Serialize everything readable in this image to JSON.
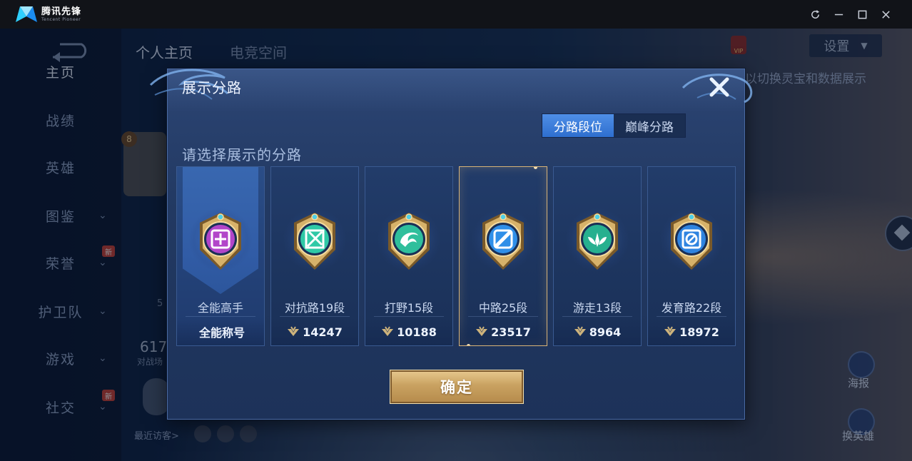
{
  "window": {
    "brand_name": "腾讯先锋",
    "brand_subtitle": "Tencent Pioneer",
    "controls": [
      "refresh-icon",
      "minimize-icon",
      "maximize-icon",
      "close-icon"
    ]
  },
  "game": {
    "nav_items": [
      {
        "label": "主页",
        "active": true
      },
      {
        "label": "战绩"
      },
      {
        "label": "英雄"
      },
      {
        "label": "图鉴",
        "chevron": true
      },
      {
        "label": "荣誉",
        "chevron": true,
        "badge": "新"
      },
      {
        "label": "护卫队",
        "chevron": true
      },
      {
        "label": "游戏",
        "chevron": true
      },
      {
        "label": "社交",
        "chevron": true,
        "badge": "新"
      }
    ],
    "top_tabs": [
      "个人主页",
      "电竞空间"
    ],
    "settings_label": "设置",
    "hint_text": "以切换灵宝和数据展示",
    "level": "8",
    "stat_number": "617",
    "stat_label": "对战场",
    "five_label": "5",
    "visitors_label": "最近访客>",
    "right_buttons": [
      "海报",
      "换英雄"
    ]
  },
  "modal": {
    "title": "展示分路",
    "tabs": [
      {
        "label": "分路段位",
        "selected": true
      },
      {
        "label": "巅峰分路",
        "selected": false
      }
    ],
    "prompt": "请选择展示的分路",
    "cards": [
      {
        "name": "全能高手",
        "score": "全能称号",
        "emblem": "all-round-emblem",
        "color": "#b245c9",
        "banner": true
      },
      {
        "name": "对抗路19段",
        "score": "14247",
        "emblem": "clash-lane-emblem",
        "color": "#2fc9a6"
      },
      {
        "name": "打野15段",
        "score": "10188",
        "emblem": "jungle-emblem",
        "color": "#2fbf9c"
      },
      {
        "name": "中路25段",
        "score": "23517",
        "emblem": "mid-lane-emblem",
        "color": "#2f8fe8",
        "selected": true
      },
      {
        "name": "游走13段",
        "score": "8964",
        "emblem": "roam-emblem",
        "color": "#27b08f"
      },
      {
        "name": "发育路22段",
        "score": "18972",
        "emblem": "farm-lane-emblem",
        "color": "#2f84e0"
      }
    ],
    "confirm_label": "确定"
  }
}
